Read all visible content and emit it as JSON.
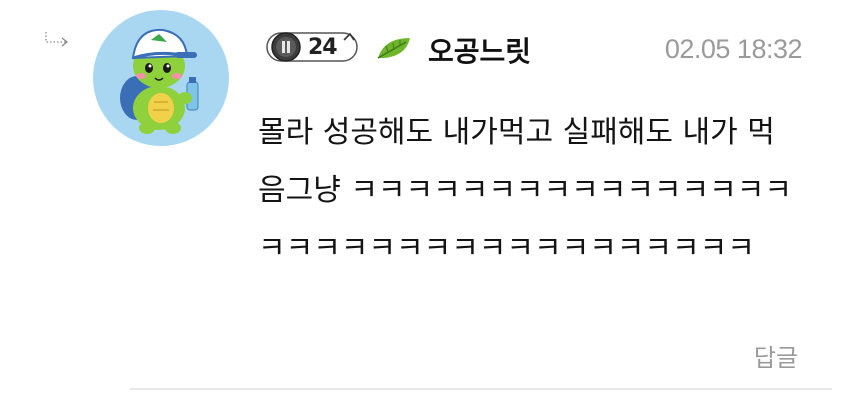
{
  "comment": {
    "level": "24",
    "nickname": "오공느릿",
    "timestamp": "02.05 18:32",
    "body": "몰라 성공해도 내가먹고 실패해도 내가 먹음그냥 ㅋㅋㅋㅋㅋㅋㅋㅋㅋㅋㅋㅋㅋㅋㅋㅋㅋㅋㅋㅋㅋㅋㅋㅋㅋㅋㅋㅋㅋㅋㅋㅋㅋㅋ",
    "reply_label": "답글"
  },
  "icons": {
    "reply_indicator": "reply-arrow-icon",
    "avatar": "turtle-character-avatar",
    "level_badge": "level-badge-icon",
    "leaf": "leaf-icon"
  },
  "colors": {
    "avatar_background": "#a9d7f2",
    "meta_text": "#9a9a9a",
    "leaf_green": "#6fb52c"
  }
}
